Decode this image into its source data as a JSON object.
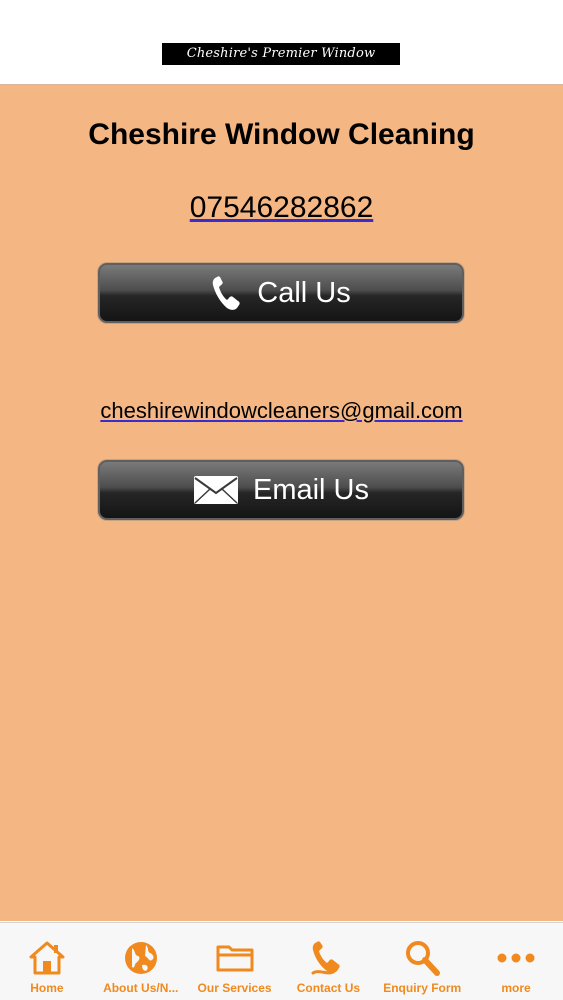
{
  "header": {
    "banner_text": "Cheshire's Premier Window Cleaners"
  },
  "main": {
    "title": "Cheshire Window Cleaning",
    "phone": "07546282862",
    "call_button_label": "Call Us",
    "email": "cheshirewindowcleaners@gmail.com",
    "email_button_label": "Email Us"
  },
  "tabbar": {
    "items": [
      {
        "label": "Home",
        "icon": "home-icon"
      },
      {
        "label": "About Us/N...",
        "icon": "globe-icon"
      },
      {
        "label": "Our Services",
        "icon": "folder-icon"
      },
      {
        "label": "Contact Us",
        "icon": "phone-icon"
      },
      {
        "label": "Enquiry Form",
        "icon": "search-icon"
      },
      {
        "label": "more",
        "icon": "more-dots-icon"
      }
    ]
  },
  "colors": {
    "background": "#f4b683",
    "tab_accent": "#f08a1e",
    "button_dark": "#1a1a1a"
  }
}
